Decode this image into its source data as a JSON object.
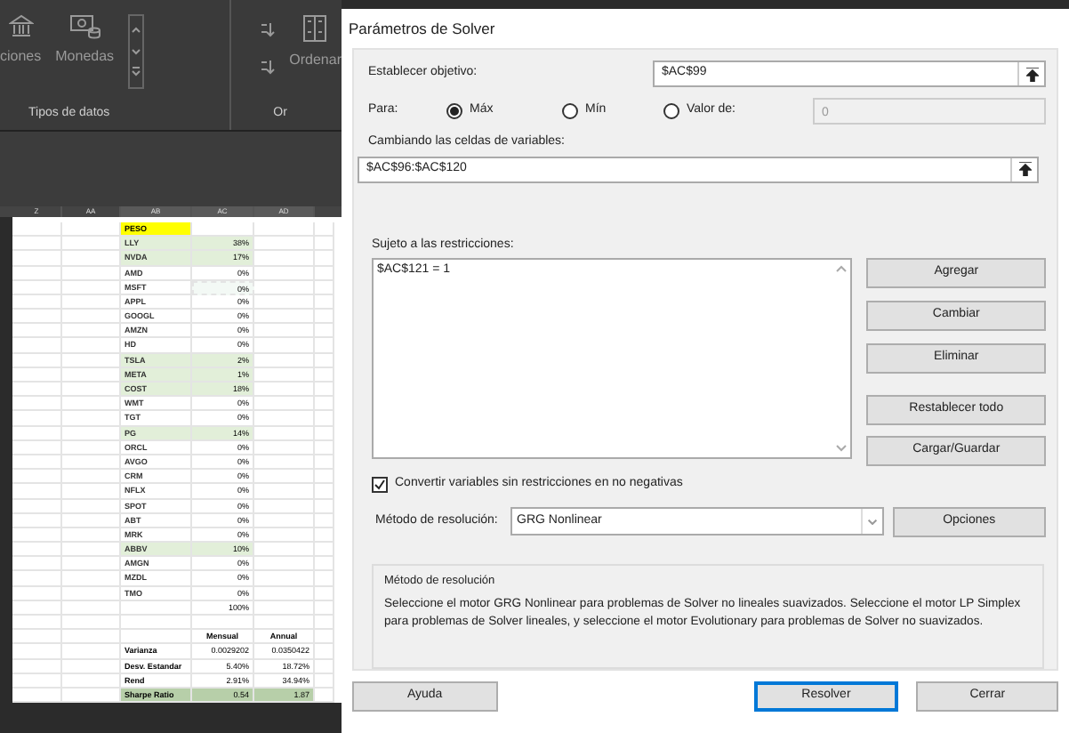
{
  "ribbon": {
    "groups": [
      {
        "items": [
          {
            "kind": "bank",
            "label": "ciones"
          },
          {
            "kind": "currency",
            "label": "Monedas"
          }
        ],
        "label": "Tipos de datos"
      },
      {
        "items": [
          {
            "kind": "sort",
            "label": "Ordenar"
          }
        ],
        "label": "Or"
      }
    ]
  },
  "sheet": {
    "columns": [
      "Z",
      "AA",
      "AB",
      "AC",
      "AD"
    ],
    "rows": [
      {
        "kind": "header",
        "name": "PESO"
      },
      {
        "kind": "weight",
        "name": "LLY",
        "value": "38%",
        "highlighted": true,
        "selected": false
      },
      {
        "kind": "weight",
        "name": "NVDA",
        "value": "17%",
        "highlighted": true,
        "selected": false
      },
      {
        "kind": "weight",
        "name": "AMD",
        "value": "0%",
        "highlighted": false,
        "selected": false
      },
      {
        "kind": "weight",
        "name": "MSFT",
        "value": "0%",
        "highlighted": false,
        "selected": true
      },
      {
        "kind": "weight",
        "name": "APPL",
        "value": "0%",
        "highlighted": false,
        "selected": false
      },
      {
        "kind": "weight",
        "name": "GOOGL",
        "value": "0%",
        "highlighted": false,
        "selected": false
      },
      {
        "kind": "weight",
        "name": "AMZN",
        "value": "0%",
        "highlighted": false,
        "selected": false
      },
      {
        "kind": "weight",
        "name": "HD",
        "value": "0%",
        "highlighted": false,
        "selected": false
      },
      {
        "kind": "weight",
        "name": "TSLA",
        "value": "2%",
        "highlighted": true,
        "selected": false
      },
      {
        "kind": "weight",
        "name": "META",
        "value": "1%",
        "highlighted": true,
        "selected": false
      },
      {
        "kind": "weight",
        "name": "COST",
        "value": "18%",
        "highlighted": true,
        "selected": false
      },
      {
        "kind": "weight",
        "name": "WMT",
        "value": "0%",
        "highlighted": false,
        "selected": false
      },
      {
        "kind": "weight",
        "name": "TGT",
        "value": "0%",
        "highlighted": false,
        "selected": false
      },
      {
        "kind": "weight",
        "name": "PG",
        "value": "14%",
        "highlighted": true,
        "selected": false
      },
      {
        "kind": "weight",
        "name": "ORCL",
        "value": "0%",
        "highlighted": false,
        "selected": false
      },
      {
        "kind": "weight",
        "name": "AVGO",
        "value": "0%",
        "highlighted": false,
        "selected": false
      },
      {
        "kind": "weight",
        "name": "CRM",
        "value": "0%",
        "highlighted": false,
        "selected": false
      },
      {
        "kind": "weight",
        "name": "NFLX",
        "value": "0%",
        "highlighted": false,
        "selected": false
      },
      {
        "kind": "weight",
        "name": "SPOT",
        "value": "0%",
        "highlighted": false,
        "selected": false
      },
      {
        "kind": "weight",
        "name": "ABT",
        "value": "0%",
        "highlighted": false,
        "selected": false
      },
      {
        "kind": "weight",
        "name": "MRK",
        "value": "0%",
        "highlighted": false,
        "selected": false
      },
      {
        "kind": "weight",
        "name": "ABBV",
        "value": "10%",
        "highlighted": true,
        "selected": false
      },
      {
        "kind": "weight",
        "name": "AMGN",
        "value": "0%",
        "highlighted": false,
        "selected": false
      },
      {
        "kind": "weight",
        "name": "MZDL",
        "value": "0%",
        "highlighted": false,
        "selected": false
      },
      {
        "kind": "weight",
        "name": "TMO",
        "value": "0%",
        "highlighted": false,
        "selected": false
      },
      {
        "kind": "total",
        "value": "100%"
      },
      {
        "kind": "blank"
      },
      {
        "kind": "stats_header",
        "mensual": "Mensual",
        "annual": "Annual"
      },
      {
        "kind": "stat",
        "name": "Varianza",
        "mensual": "0.0029202",
        "annual": "0.0350422",
        "highlighted": false
      },
      {
        "kind": "stat",
        "name": "Desv. Estandar",
        "mensual": "5.40%",
        "annual": "18.72%",
        "highlighted": false
      },
      {
        "kind": "stat",
        "name": "Rend",
        "mensual": "2.91%",
        "annual": "34.94%",
        "highlighted": false
      },
      {
        "kind": "stat",
        "name": "Sharpe Ratio",
        "mensual": "0.54",
        "annual": "1.87",
        "highlighted": true
      }
    ]
  },
  "dialog": {
    "title": "Parámetros de Solver",
    "objective": {
      "label": "Establecer objetivo:",
      "value": "$AC$99"
    },
    "para": {
      "label": "Para:",
      "options": [
        {
          "label": "Máx",
          "selected": true
        },
        {
          "label": "Mín",
          "selected": false
        },
        {
          "label": "Valor de:",
          "selected": false
        }
      ],
      "value_field": {
        "value": "0",
        "disabled": true
      }
    },
    "variables": {
      "label": "Cambiando las celdas de variables:",
      "value": "$AC$96:$AC$120"
    },
    "constraints": {
      "label": "Sujeto a las restricciones:",
      "items": [
        "$AC$121 = 1"
      ]
    },
    "side_buttons": [
      "Agregar",
      "Cambiar",
      "Eliminar",
      "Restablecer todo",
      "Cargar/Guardar"
    ],
    "nonnegative": {
      "label": "Convertir variables sin restricciones en no negativas",
      "checked": true
    },
    "method": {
      "label": "Método de resolución:",
      "value": "GRG Nonlinear",
      "options_button": "Opciones"
    },
    "method_info": {
      "title": "Método de resolución",
      "text": "Seleccione el motor GRG Nonlinear para problemas de Solver no lineales suavizados. Seleccione el motor LP Simplex para problemas de Solver lineales, y seleccione el motor Evolutionary para problemas de Solver no suavizados."
    },
    "footer_buttons": [
      {
        "label": "Ayuda",
        "default": false
      },
      {
        "label": "Resolver",
        "default": true
      },
      {
        "label": "Cerrar",
        "default": false
      }
    ]
  }
}
